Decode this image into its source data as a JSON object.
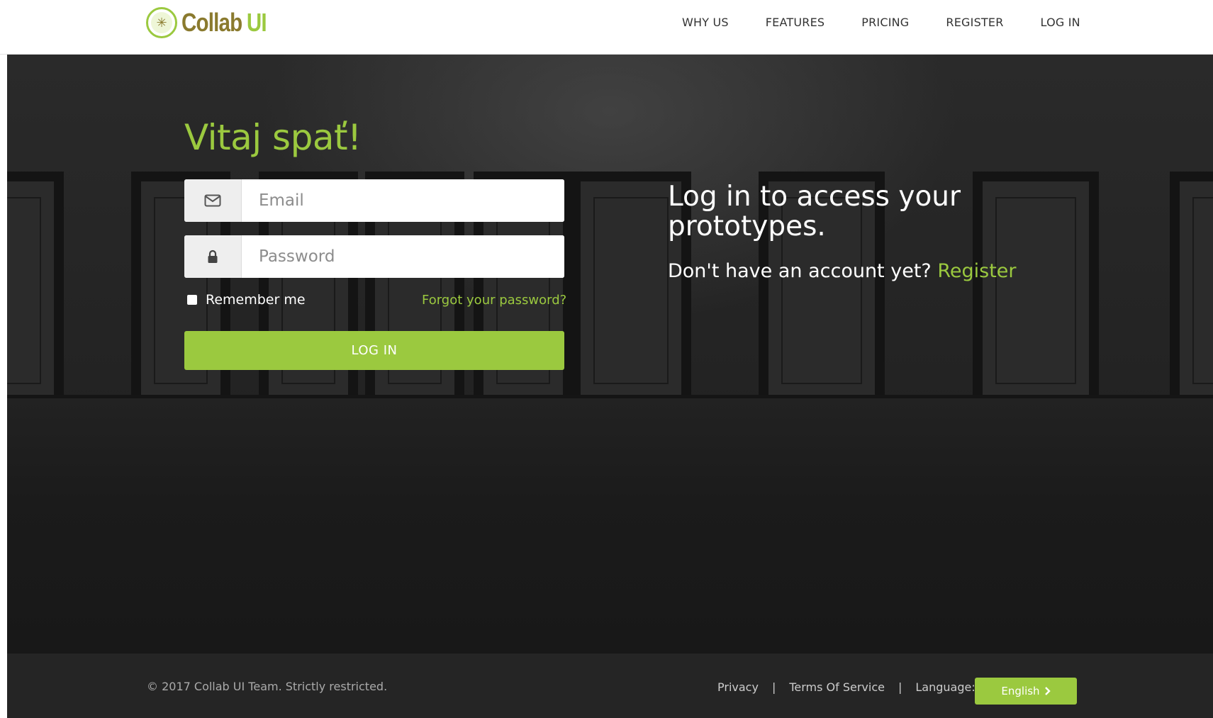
{
  "brand": {
    "name_part1": "Collab",
    "name_part2": "UI",
    "logo_icon": "compass-logo-icon"
  },
  "nav": {
    "items": [
      {
        "label": "WHY US"
      },
      {
        "label": "FEATURES"
      },
      {
        "label": "PRICING"
      },
      {
        "label": "REGISTER"
      },
      {
        "label": "LOG IN"
      }
    ]
  },
  "login": {
    "heading": "Vitaj spať!",
    "email": {
      "placeholder": "Email",
      "value": "",
      "icon": "envelope-icon"
    },
    "password": {
      "placeholder": "Password",
      "value": "",
      "icon": "lock-icon"
    },
    "remember_label": "Remember me",
    "remember_checked": false,
    "forgot_link": "Forgot your password?",
    "submit_label": "LOG IN"
  },
  "promo": {
    "headline": "Log in to access your prototypes.",
    "no_account_text": "Don't have an account yet?",
    "register_link": "Register"
  },
  "footer": {
    "copyright": "© 2017 Collab UI Team. Strictly restricted.",
    "privacy": "Privacy",
    "separator": "|",
    "terms": "Terms Of Service",
    "language_label": "Language:",
    "language_value": "English",
    "language_icon": "chevron-right-icon"
  },
  "colors": {
    "accent": "#9bc93f",
    "brand_dark": "#8a7a2e",
    "footer_bg": "#252525"
  }
}
